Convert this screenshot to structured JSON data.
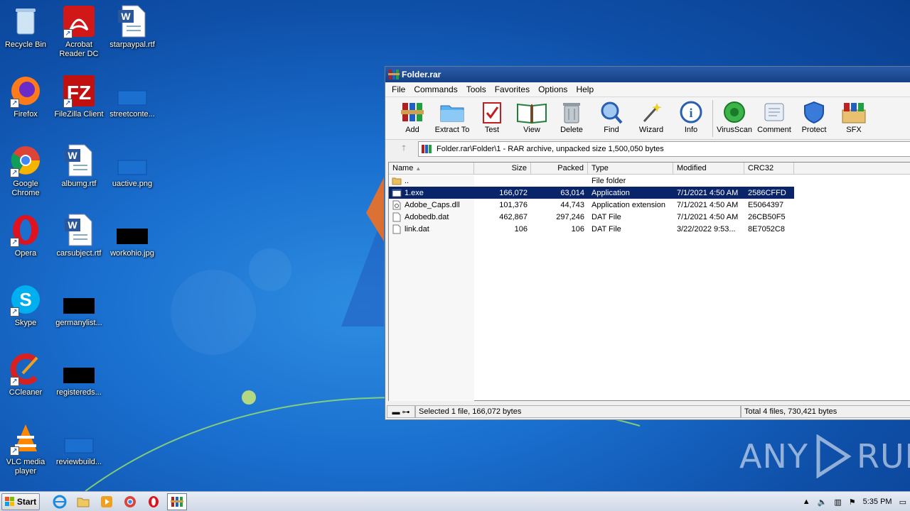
{
  "desktop": {
    "icons": [
      {
        "label": "Recycle Bin"
      },
      {
        "label": "Acrobat Reader DC"
      },
      {
        "label": "starpaypal.rtf"
      },
      {
        "label": "Firefox"
      },
      {
        "label": "FileZilla Client"
      },
      {
        "label": "streetconte..."
      },
      {
        "label": "Google Chrome"
      },
      {
        "label": "albumg.rtf"
      },
      {
        "label": "uactive.png"
      },
      {
        "label": "Opera"
      },
      {
        "label": "carsubject.rtf"
      },
      {
        "label": "workohio.jpg"
      },
      {
        "label": "Skype"
      },
      {
        "label": "germanylist..."
      },
      {
        "label": "CCleaner"
      },
      {
        "label": "registereds..."
      },
      {
        "label": "VLC media player"
      },
      {
        "label": "reviewbuild..."
      }
    ]
  },
  "window": {
    "title": "Folder.rar",
    "menu": [
      "File",
      "Commands",
      "Tools",
      "Favorites",
      "Options",
      "Help"
    ],
    "toolbar": [
      "Add",
      "Extract To",
      "Test",
      "View",
      "Delete",
      "Find",
      "Wizard",
      "Info",
      "VirusScan",
      "Comment",
      "Protect",
      "SFX"
    ],
    "address": "Folder.rar\\Folder\\1 - RAR archive, unpacked size 1,500,050 bytes",
    "columns": [
      "Name",
      "Size",
      "Packed",
      "Type",
      "Modified",
      "CRC32"
    ],
    "files": [
      {
        "name": "..",
        "size": "",
        "packed": "",
        "type": "File folder",
        "modified": "",
        "crc": ""
      },
      {
        "name": "1.exe",
        "size": "166,072",
        "packed": "63,014",
        "type": "Application",
        "modified": "7/1/2021 4:50 AM",
        "crc": "2586CFFD"
      },
      {
        "name": "Adobe_Caps.dll",
        "size": "101,376",
        "packed": "44,743",
        "type": "Application extension",
        "modified": "7/1/2021 4:50 AM",
        "crc": "E5064397"
      },
      {
        "name": "Adobedb.dat",
        "size": "462,867",
        "packed": "297,246",
        "type": "DAT File",
        "modified": "7/1/2021 4:50 AM",
        "crc": "26CB50F5"
      },
      {
        "name": "link.dat",
        "size": "106",
        "packed": "106",
        "type": "DAT File",
        "modified": "3/22/2022 9:53...",
        "crc": "8E7052C8"
      }
    ],
    "status_left": "Selected 1 file, 166,072 bytes",
    "status_right": "Total 4 files, 730,421 bytes"
  },
  "watermark": {
    "left": "ANY",
    "right": "RUN"
  },
  "taskbar": {
    "start": "Start",
    "clock": "5:35 PM"
  }
}
